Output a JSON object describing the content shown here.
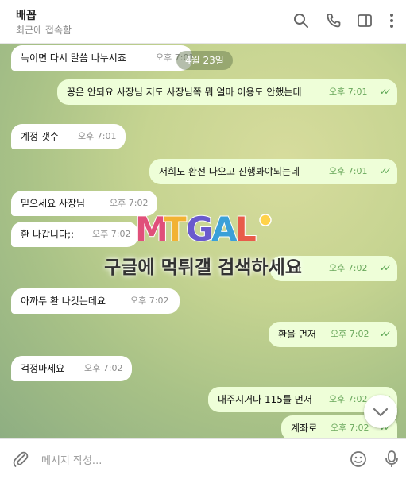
{
  "header": {
    "title": "배꼽",
    "status": "최근에 접속함"
  },
  "date_badge": "4월 23일",
  "messages": [
    {
      "text": "녹이면 다시 말씀 나누시죠",
      "time": "오후 7:01"
    },
    {
      "text": "꽁은 안되요 사장님 저도 사장님쪽 뭐 얼마 이용도 안했는데",
      "time": "오후 7:01"
    },
    {
      "text": "계정 갯수",
      "time": "오후 7:01"
    },
    {
      "text": "저희도 환전 나오고 진행봐야되는데",
      "time": "오후 7:01"
    },
    {
      "text": "믿으세요 사장님",
      "time": "오후 7:02"
    },
    {
      "text": "환 나갑니다;;",
      "time": "오후 7:02"
    },
    {
      "text": "라",
      "time": "오후 7:02"
    },
    {
      "text": "아까두 환 나갓는데요",
      "time": "오후 7:02"
    },
    {
      "text": "환을 먼저",
      "time": "오후 7:02"
    },
    {
      "text": "걱정마세요",
      "time": "오후 7:02"
    },
    {
      "text": "내주시거나 115를 먼저",
      "time": "오후 7:02"
    },
    {
      "text": "계좌로",
      "time": "오후 7:02"
    }
  ],
  "watermark": {
    "logo": "MTGAL",
    "text": "구글에 먹튀갤 검색하세요"
  },
  "composer": {
    "placeholder": "메시지 작성..."
  },
  "icons": [
    "search-icon",
    "phone-icon",
    "sidebar-toggle-icon",
    "more-vertical-icon",
    "chevron-down-icon",
    "attach-icon",
    "emoji-icon",
    "microphone-icon"
  ],
  "colors": {
    "incoming": "#ffffff",
    "outgoing": "#eefed8",
    "read_check": "#5aa552"
  }
}
